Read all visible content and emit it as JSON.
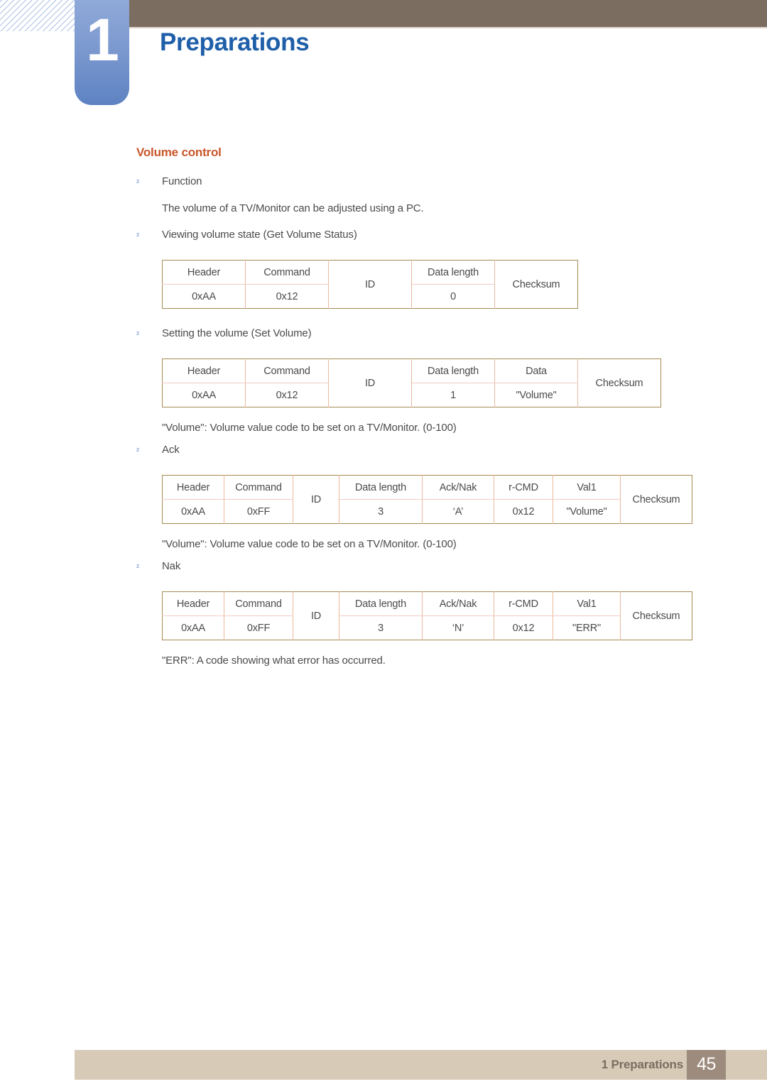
{
  "chapter": {
    "number": "1",
    "title": "Preparations"
  },
  "section": {
    "heading": "Volume control"
  },
  "bullets": {
    "function": "Function",
    "function_desc": "The volume of a TV/Monitor can be adjusted using a PC.",
    "get_volume": "Viewing volume state (Get Volume Status)",
    "set_volume": "Setting the volume (Set Volume)",
    "volume_note_1": "\"Volume\": Volume value code to be set on a TV/Monitor. (0-100)",
    "ack": "Ack",
    "volume_note_2": "\"Volume\": Volume value code to be set on a TV/Monitor. (0-100)",
    "nak": "Nak",
    "err_note": "\"ERR\": A code showing what error has occurred."
  },
  "bullet_glyph": "z",
  "tables": {
    "get_volume_status": {
      "widths": [
        117,
        117,
        117,
        117,
        117
      ],
      "header": [
        "Header",
        "Command",
        "ID",
        "Data length",
        "Checksum"
      ],
      "values": [
        "0xAA",
        "0x12",
        "",
        "0",
        ""
      ],
      "spans": [
        false,
        false,
        true,
        false,
        true
      ]
    },
    "set_volume": {
      "widths": [
        117,
        117,
        117,
        117,
        117,
        117
      ],
      "header": [
        "Header",
        "Command",
        "ID",
        "Data length",
        "Data",
        "Checksum"
      ],
      "values": [
        "0xAA",
        "0x12",
        "",
        "1",
        "\"Volume\"",
        ""
      ],
      "spans": [
        false,
        false,
        true,
        false,
        false,
        true
      ]
    },
    "ack": {
      "widths": [
        87,
        97,
        65,
        117,
        101,
        83,
        95,
        101
      ],
      "header": [
        "Header",
        "Command",
        "ID",
        "Data length",
        "Ack/Nak",
        "r-CMD",
        "Val1",
        "Checksum"
      ],
      "values": [
        "0xAA",
        "0xFF",
        "",
        "3",
        "‘A’",
        "0x12",
        "\"Volume\"",
        ""
      ],
      "spans": [
        false,
        false,
        true,
        false,
        false,
        false,
        false,
        true
      ]
    },
    "nak": {
      "widths": [
        87,
        97,
        65,
        117,
        101,
        83,
        95,
        101
      ],
      "header": [
        "Header",
        "Command",
        "ID",
        "Data length",
        "Ack/Nak",
        "r-CMD",
        "Val1",
        "Checksum"
      ],
      "values": [
        "0xAA",
        "0xFF",
        "",
        "3",
        "‘N’",
        "0x12",
        "\"ERR\"",
        ""
      ],
      "spans": [
        false,
        false,
        true,
        false,
        false,
        false,
        false,
        true
      ]
    }
  },
  "footer": {
    "label": "1 Preparations",
    "page": "45"
  },
  "colors": {
    "header_bar": "#7b6d60",
    "chapter_title": "#1f5fa9",
    "section_heading": "#c9562a",
    "badge_blue": "#7e9bd0",
    "footer_bar": "#d7cab7",
    "footer_page_box": "#9d8b7d",
    "table_outer_border": "#a58a52",
    "table_inner_border": "#ecb89c"
  }
}
